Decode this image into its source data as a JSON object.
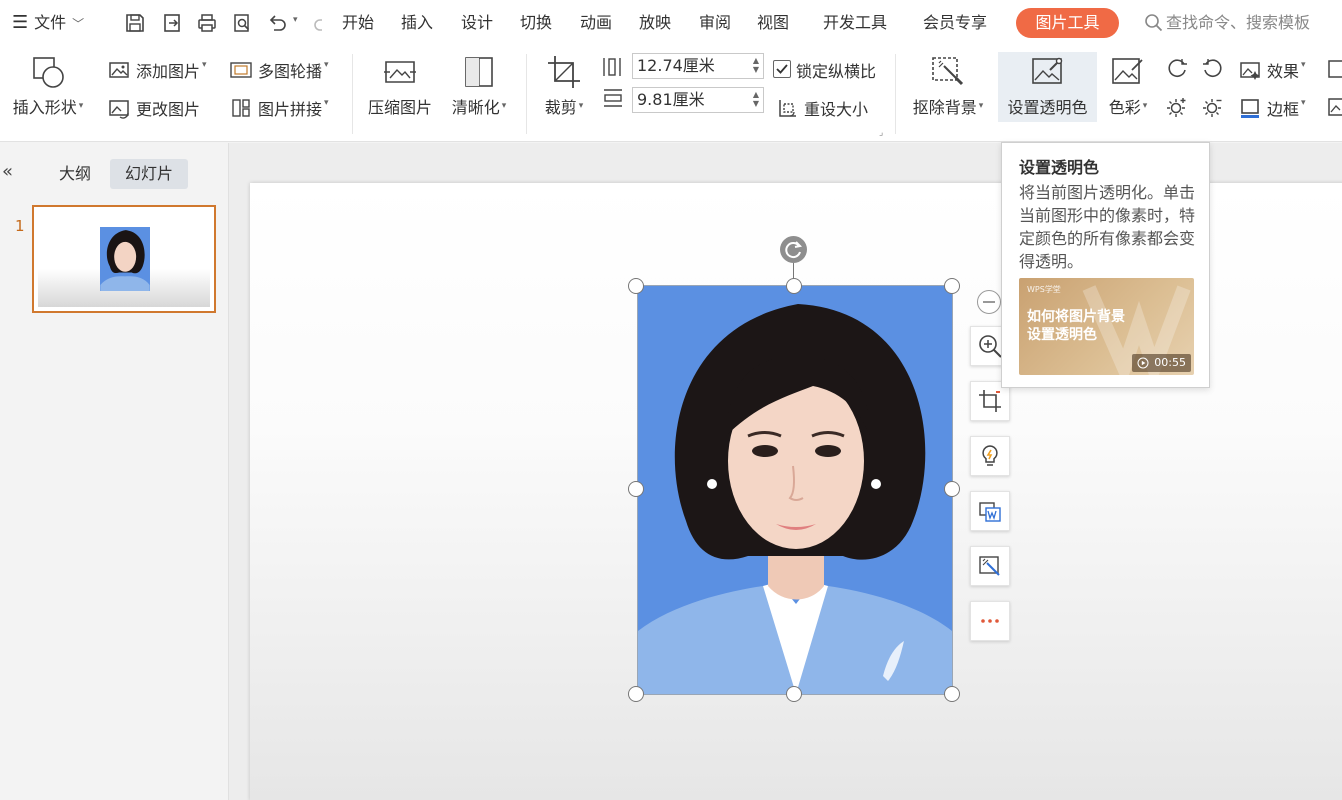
{
  "menu": {
    "file": "文件",
    "tabs": [
      "开始",
      "插入",
      "设计",
      "切换",
      "动画",
      "放映",
      "审阅",
      "视图",
      "开发工具",
      "会员专享"
    ],
    "active_tab": "图片工具",
    "search_placeholder": "查找命令、搜索模板"
  },
  "ribbon": {
    "insert_shape": "插入形状",
    "add_picture": "添加图片",
    "change_picture": "更改图片",
    "multi_carousel": "多图轮播",
    "picture_stitch": "图片拼接",
    "compress_picture": "压缩图片",
    "sharpen": "清晰化",
    "crop": "裁剪",
    "height_value": "12.74厘米",
    "width_value": "9.81厘米",
    "lock_aspect": "锁定纵横比",
    "lock_aspect_checked": true,
    "reset_size": "重设大小",
    "remove_background": "抠除背景",
    "set_transparent": "设置透明色",
    "color": "色彩",
    "effects": "效果",
    "border": "边框"
  },
  "left_panel": {
    "tabs": [
      "大纲",
      "幻灯片"
    ],
    "active": "幻灯片",
    "slide_number": "1"
  },
  "tooltip": {
    "title": "设置透明色",
    "description": "将当前图片透明化。单击当前图形中的像素时，特定颜色的所有像素都会变得透明。",
    "video_brand": "WPS学堂",
    "video_title_line1": "如何将图片背景",
    "video_title_line2": "设置透明色",
    "video_duration": "00:55"
  },
  "colors": {
    "accent_tab": "#f06a45",
    "photo_background": "#5b90e2",
    "thumbnail_border": "#d0782e"
  }
}
